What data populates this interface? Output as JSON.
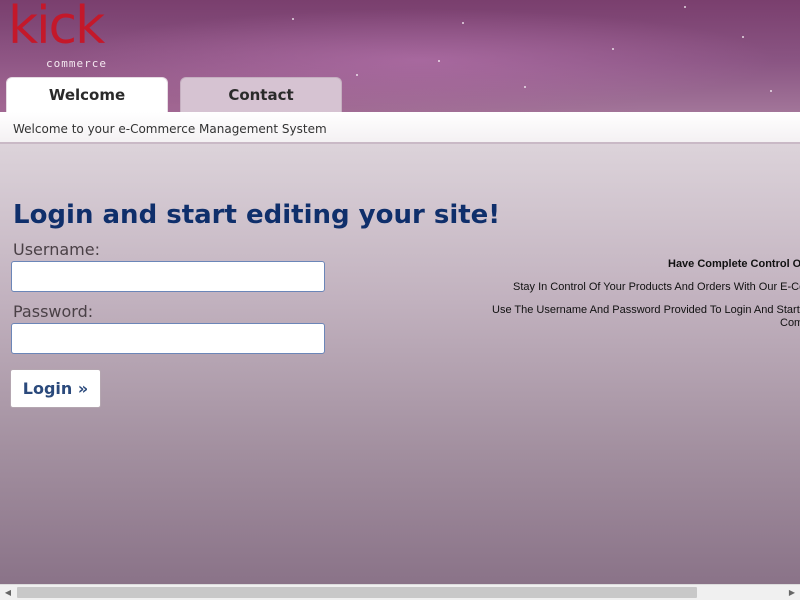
{
  "logo": {
    "main": "kick",
    "sub": "commerce"
  },
  "tabs": [
    {
      "label": "Welcome",
      "active": true
    },
    {
      "label": "Contact",
      "active": false
    }
  ],
  "subbar": {
    "text": "Welcome to your e-Commerce Management System"
  },
  "login": {
    "title": "Login and start editing your site!",
    "username_label": "Username:",
    "username_value": "",
    "password_label": "Password:",
    "password_value": "",
    "button_label": "Login »"
  },
  "info": {
    "line1": "Have Complete Control O",
    "line2": "Stay In Control Of Your Products And Orders With Our E-Co",
    "line3a": "Use The Username And Password Provided To Login And Start",
    "line3b": "Com"
  },
  "colors": {
    "brand_red": "#c4182a",
    "title_blue": "#0f2f6b",
    "header_purple": "#7a3f6e"
  },
  "scrollbar": {
    "left_arrow": "◀",
    "right_arrow": "▶"
  }
}
